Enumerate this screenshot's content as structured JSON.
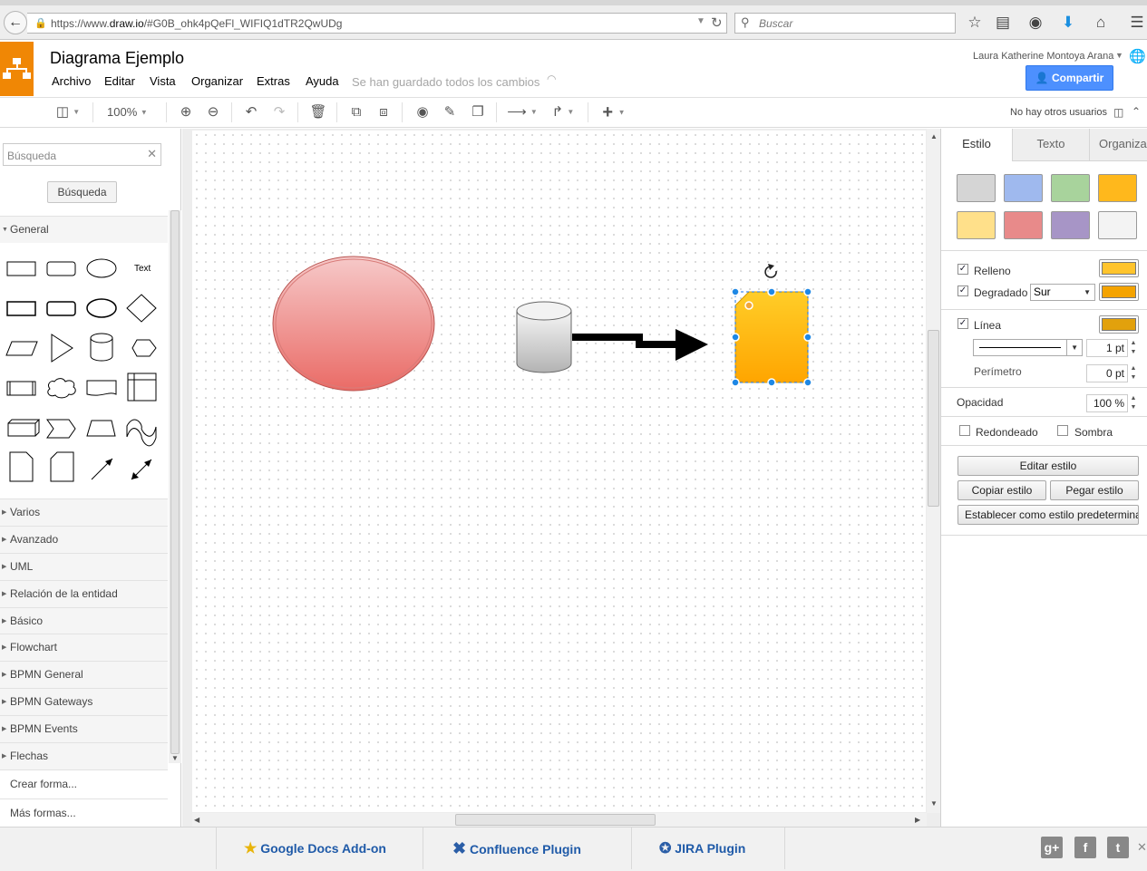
{
  "browser": {
    "url_prefix": "https://www.",
    "url_domain": "draw.io",
    "url_rest": "/#G0B_ohk4pQeFl_WIFIQ1dTR2QwUDg",
    "search_placeholder": "Buscar"
  },
  "app": {
    "title": "Diagrama Ejemplo",
    "menu": [
      "Archivo",
      "Editar",
      "Vista",
      "Organizar",
      "Extras",
      "Ayuda"
    ],
    "save_status": "Se han guardado todos los cambios",
    "user": "Laura Katherine Montoya Arana",
    "share_label": "Compartir"
  },
  "toolbar": {
    "zoom": "100%",
    "collab_status": "No hay otros usuarios"
  },
  "sidebar": {
    "search_placeholder": "Búsqueda",
    "search_button": "Búsqueda",
    "general_label": "General",
    "text_shape": "Text",
    "categories": [
      "Varios",
      "Avanzado",
      "UML",
      "Relación de la entidad",
      "Básico",
      "Flowchart",
      "BPMN General",
      "BPMN Gateways",
      "BPMN Events",
      "Flechas"
    ],
    "create_shape": "Crear forma...",
    "more_shapes": "Más formas..."
  },
  "panel": {
    "tabs": [
      "Estilo",
      "Texto",
      "Organizar"
    ],
    "swatches": [
      "#d5d5d5",
      "#9fb9ee",
      "#a8d39c",
      "#ffb81c",
      "#ffe08a",
      "#e88a8a",
      "#a795c6",
      "#f3f3f3"
    ],
    "fill_label": "Relleno",
    "fill_color": "#ffc42c",
    "gradient_label": "Degradado",
    "gradient_direction": "Sur",
    "gradient_color": "#f4a300",
    "line_label": "Línea",
    "line_color": "#e2a10c",
    "line_width": "1 pt",
    "perimeter_label": "Perímetro",
    "perimeter_value": "0 pt",
    "opacity_label": "Opacidad",
    "opacity_value": "100 %",
    "rounded_label": "Redondeado",
    "shadow_label": "Sombra",
    "edit_style": "Editar estilo",
    "copy_style": "Copiar estilo",
    "paste_style": "Pegar estilo",
    "set_default": "Establecer como estilo predeterminado"
  },
  "bottom": {
    "plugins": [
      "Google Docs Add-on",
      "Confluence Plugin",
      "JIRA Plugin"
    ],
    "social": [
      "g+",
      "f",
      "t"
    ]
  },
  "icons": [
    "lock-icon",
    "reload-icon",
    "star-icon",
    "clipboard-icon",
    "pocket-icon",
    "download-icon",
    "home-icon",
    "hamburger-icon",
    "drawio-logo",
    "globe-icon",
    "user-icon",
    "zoom-in-icon",
    "zoom-out-icon",
    "undo-icon",
    "redo-icon",
    "trash-icon",
    "to-front-icon",
    "to-back-icon",
    "fill-icon",
    "line-color-icon",
    "shadow-icon",
    "plus-icon",
    "rotate-icon",
    "close-icon"
  ]
}
